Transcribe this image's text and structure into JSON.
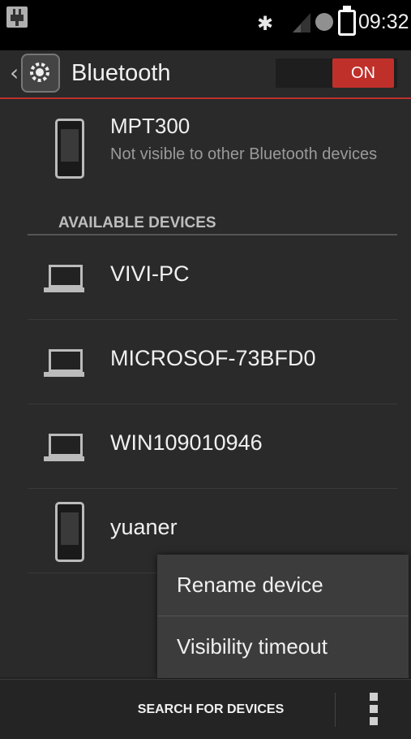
{
  "status_bar": {
    "time": "09:32",
    "bt_glyph": "✱",
    "icons": [
      "usb-icon",
      "bluetooth-icon",
      "signal-icon",
      "status-dot-icon",
      "battery-icon"
    ]
  },
  "action_bar": {
    "title": "Bluetooth",
    "toggle_label": "ON",
    "accent_color": "#c0302b"
  },
  "my_device": {
    "name": "MPT300",
    "subtitle": "Not visible to other Bluetooth devices"
  },
  "available_devices": {
    "header": "AVAILABLE DEVICES",
    "items": [
      {
        "name": "VIVI-PC",
        "icon": "laptop-icon"
      },
      {
        "name": "MICROSOF-73BFD0",
        "icon": "laptop-icon"
      },
      {
        "name": "WIN109010946",
        "icon": "laptop-icon"
      },
      {
        "name": "yuaner",
        "icon": "phone-icon"
      }
    ]
  },
  "overflow_menu": {
    "items": [
      "Rename device",
      "Visibility timeout"
    ]
  },
  "bottom_bar": {
    "search_label": "SEARCH FOR DEVICES"
  }
}
